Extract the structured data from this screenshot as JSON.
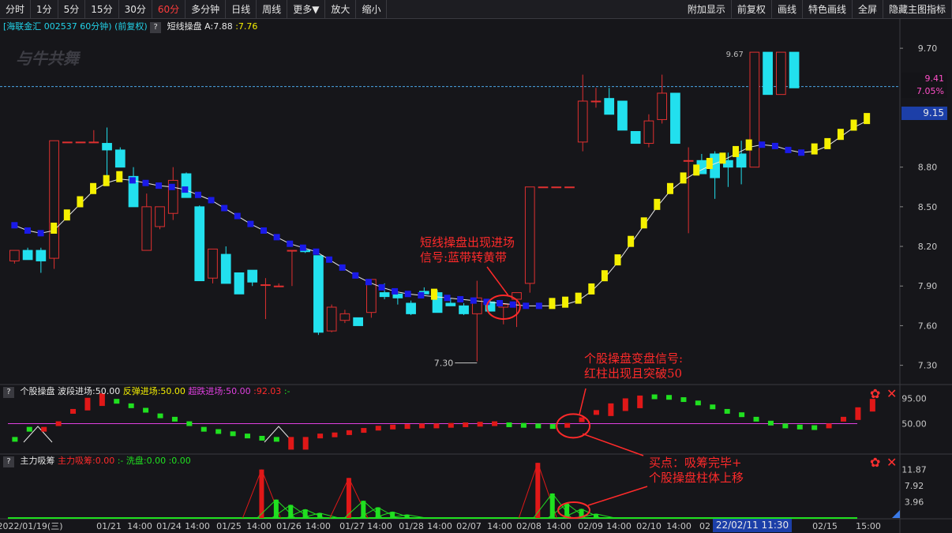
{
  "toolbar": {
    "left": [
      "分时",
      "1分",
      "5分",
      "15分",
      "30分",
      "60分",
      "多分钟",
      "日线",
      "周线",
      "更多▼",
      "放大",
      "缩小"
    ],
    "active": "60分",
    "right": [
      "附加显示",
      "前复权",
      "画线",
      "特色画线",
      "全屏",
      "隐藏主图指标"
    ]
  },
  "info": {
    "name": "[海联金汇",
    "code_period": "002537 60分钟)",
    "adjust": "(前复权)",
    "q": "?",
    "indicator": "短线操盘",
    "a_label": "A:7.88",
    "a_value": ":7.76"
  },
  "watermark": "与牛共舞",
  "price_axis": {
    "ticks": [
      "9.70",
      "9.41",
      "9.15",
      "8.80",
      "8.50",
      "8.20",
      "7.90",
      "7.60",
      "7.30"
    ],
    "current_price": "9.41",
    "current_pct": "7.05%",
    "box_price": "9.15",
    "high_label": "9.67",
    "low_label": "7.30"
  },
  "panel2": {
    "title": "个股操盘",
    "l1": "波段进场:50.00",
    "l2": "反弹进场:50.00",
    "l3": "超跌进场:50.00",
    "l4": ":92.03",
    "l5": ":-",
    "ticks": [
      "95.00",
      "50.00"
    ]
  },
  "panel3": {
    "title": "主力吸筹",
    "l1": "主力吸筹:0.00",
    "l2": ":-",
    "l3": "洗盘:0.00",
    "l4": ":0.00",
    "ticks": [
      "11.87",
      "7.92",
      "3.96"
    ]
  },
  "dates": [
    "2022/01/19(三)",
    "01/21",
    "14:00",
    "01/24",
    "14:00",
    "01/25",
    "14:00",
    "01/26",
    "14:00",
    "01/27",
    "14:00",
    "01/28",
    "14:00",
    "02/07",
    "14:00",
    "02/08",
    "14:00",
    "02/09",
    "14:00",
    "02/10",
    "14:00",
    "02",
    "2/14",
    "14:00",
    "02/15",
    "15:00"
  ],
  "time_box": "22/02/11 11:30",
  "annotations": {
    "a1": [
      "短线操盘出现进场",
      "信号:蓝带转黄带"
    ],
    "a2": [
      "个股操盘变盘信号:",
      "红柱出现且突破50"
    ],
    "a3": [
      "买点：吸筹完毕+",
      "个股操盘柱体上移"
    ]
  },
  "controls": {
    "gear": "✿",
    "close": "✕"
  },
  "colors": {
    "up": "#e03030",
    "down": "#22e0ee",
    "band_yellow": "#f5f000",
    "band_blue": "#1a1ae8",
    "macd_green": "#20e020",
    "macd_red": "#e01818",
    "fifty_line": "#e040e0",
    "annotation": "#ff2a2a"
  },
  "chart_data": {
    "type": "candlestick",
    "candles": [
      {
        "o": 8.09,
        "h": 8.16,
        "l": 8.07,
        "c": 8.17
      },
      {
        "o": 8.17,
        "h": 8.19,
        "l": 8.1,
        "c": 8.1
      },
      {
        "o": 8.17,
        "h": 8.19,
        "l": 8.0,
        "c": 8.09
      },
      {
        "o": 8.11,
        "h": 9.0,
        "l": 8.03,
        "c": 9.0
      },
      {
        "o": 8.99,
        "h": 8.99,
        "l": 8.99,
        "c": 8.99
      },
      {
        "o": 8.99,
        "h": 8.99,
        "l": 8.99,
        "c": 8.99
      },
      {
        "o": 8.99,
        "h": 9.08,
        "l": 8.99,
        "c": 8.99
      },
      {
        "o": 8.98,
        "h": 9.1,
        "l": 8.67,
        "c": 8.93
      },
      {
        "o": 8.93,
        "h": 8.95,
        "l": 8.8,
        "c": 8.8
      },
      {
        "o": 8.73,
        "h": 8.8,
        "l": 8.5,
        "c": 8.5
      },
      {
        "o": 8.17,
        "h": 8.6,
        "l": 8.17,
        "c": 8.5
      },
      {
        "o": 8.35,
        "h": 8.5,
        "l": 8.33,
        "c": 8.5
      },
      {
        "o": 8.45,
        "h": 8.8,
        "l": 8.4,
        "c": 8.7
      },
      {
        "o": 8.75,
        "h": 8.76,
        "l": 8.61,
        "c": 8.57
      },
      {
        "o": 8.5,
        "h": 8.51,
        "l": 7.94,
        "c": 7.94
      },
      {
        "o": 7.96,
        "h": 8.18,
        "l": 7.92,
        "c": 8.18
      },
      {
        "o": 8.14,
        "h": 8.2,
        "l": 7.92,
        "c": 7.92
      },
      {
        "o": 8.0,
        "h": 8.0,
        "l": 7.84,
        "c": 7.84
      },
      {
        "o": 8.02,
        "h": 8.02,
        "l": 7.9,
        "c": 7.93
      },
      {
        "o": 7.91,
        "h": 7.96,
        "l": 7.65,
        "c": 7.91
      },
      {
        "o": 7.9,
        "h": 7.92,
        "l": 7.9,
        "c": 7.9
      },
      {
        "o": 8.17,
        "h": 8.17,
        "l": 7.9,
        "c": 8.17
      },
      {
        "o": 8.17,
        "h": 8.17,
        "l": 8.15,
        "c": 8.16
      },
      {
        "o": 8.13,
        "h": 8.13,
        "l": 7.53,
        "c": 7.55
      },
      {
        "o": 7.56,
        "h": 7.76,
        "l": 7.55,
        "c": 7.74
      },
      {
        "o": 7.64,
        "h": 7.72,
        "l": 7.62,
        "c": 7.69
      },
      {
        "o": 7.66,
        "h": 7.66,
        "l": 7.6,
        "c": 7.6
      },
      {
        "o": 7.7,
        "h": 7.94,
        "l": 7.66,
        "c": 7.95
      },
      {
        "o": 7.85,
        "h": 7.92,
        "l": 7.8,
        "c": 7.82
      },
      {
        "o": 7.84,
        "h": 7.85,
        "l": 7.76,
        "c": 7.81
      },
      {
        "o": 7.77,
        "h": 7.79,
        "l": 7.68,
        "c": 7.69
      },
      {
        "o": 7.86,
        "h": 7.89,
        "l": 7.84,
        "c": 7.84
      },
      {
        "o": 7.85,
        "h": 7.87,
        "l": 7.71,
        "c": 7.7
      },
      {
        "o": 7.77,
        "h": 7.81,
        "l": 7.75,
        "c": 7.75
      },
      {
        "o": 7.75,
        "h": 7.77,
        "l": 7.68,
        "c": 7.69
      },
      {
        "o": 7.69,
        "h": 7.94,
        "l": 7.33,
        "c": 7.81
      },
      {
        "o": 7.78,
        "h": 7.79,
        "l": 7.71,
        "c": 7.71
      },
      {
        "o": 7.74,
        "h": 7.76,
        "l": 7.61,
        "c": 7.76
      },
      {
        "o": 7.8,
        "h": 7.8,
        "l": 7.59,
        "c": 7.85
      },
      {
        "o": 7.92,
        "h": 8.65,
        "l": 7.85,
        "c": 8.65
      },
      {
        "o": 8.65,
        "h": 8.65,
        "l": 8.65,
        "c": 8.65
      },
      {
        "o": 8.65,
        "h": 8.65,
        "l": 8.65,
        "c": 8.65
      },
      {
        "o": 8.65,
        "h": 8.65,
        "l": 8.65,
        "c": 8.65
      },
      {
        "o": 8.99,
        "h": 9.5,
        "l": 8.92,
        "c": 9.3
      },
      {
        "o": 9.3,
        "h": 9.4,
        "l": 9.25,
        "c": 9.3
      },
      {
        "o": 9.32,
        "h": 9.4,
        "l": 9.2,
        "c": 9.2
      },
      {
        "o": 9.3,
        "h": 9.3,
        "l": 9.08,
        "c": 9.08
      },
      {
        "o": 9.07,
        "h": 9.07,
        "l": 8.98,
        "c": 8.98
      },
      {
        "o": 8.98,
        "h": 9.2,
        "l": 8.95,
        "c": 9.15
      },
      {
        "o": 9.16,
        "h": 9.5,
        "l": 9.13,
        "c": 9.36
      },
      {
        "o": 9.36,
        "h": 9.36,
        "l": 8.98,
        "c": 8.98
      },
      {
        "o": 8.85,
        "h": 8.95,
        "l": 8.3,
        "c": 8.85
      },
      {
        "o": 8.85,
        "h": 8.9,
        "l": 8.75,
        "c": 8.75
      },
      {
        "o": 8.9,
        "h": 8.92,
        "l": 8.56,
        "c": 8.72
      },
      {
        "o": 8.85,
        "h": 8.91,
        "l": 8.65,
        "c": 8.8
      },
      {
        "o": 8.9,
        "h": 9.0,
        "l": 8.67,
        "c": 8.8
      },
      {
        "o": 8.8,
        "h": 9.67,
        "l": 8.8,
        "c": 9.67
      },
      {
        "o": 9.67,
        "h": 9.67,
        "l": 9.35,
        "c": 9.35
      },
      {
        "o": 9.35,
        "h": 9.67,
        "l": 9.35,
        "c": 9.67
      },
      {
        "o": 9.67,
        "h": 9.67,
        "l": 9.4,
        "c": 9.4
      }
    ],
    "band": [
      {
        "v": 8.36,
        "c": "b"
      },
      {
        "v": 8.32,
        "c": "b"
      },
      {
        "v": 8.3,
        "c": "b"
      },
      {
        "v": 8.32,
        "c": "y"
      },
      {
        "v": 8.42,
        "c": "y"
      },
      {
        "v": 8.52,
        "c": "y"
      },
      {
        "v": 8.62,
        "c": "y"
      },
      {
        "v": 8.68,
        "c": "y"
      },
      {
        "v": 8.71,
        "c": "y"
      },
      {
        "v": 8.7,
        "c": "b"
      },
      {
        "v": 8.68,
        "c": "b"
      },
      {
        "v": 8.66,
        "c": "b"
      },
      {
        "v": 8.65,
        "c": "b"
      },
      {
        "v": 8.63,
        "c": "b"
      },
      {
        "v": 8.59,
        "c": "b"
      },
      {
        "v": 8.55,
        "c": "b"
      },
      {
        "v": 8.49,
        "c": "b"
      },
      {
        "v": 8.43,
        "c": "b"
      },
      {
        "v": 8.37,
        "c": "b"
      },
      {
        "v": 8.32,
        "c": "b"
      },
      {
        "v": 8.27,
        "c": "b"
      },
      {
        "v": 8.22,
        "c": "b"
      },
      {
        "v": 8.19,
        "c": "b"
      },
      {
        "v": 8.16,
        "c": "b"
      },
      {
        "v": 8.1,
        "c": "b"
      },
      {
        "v": 8.04,
        "c": "b"
      },
      {
        "v": 7.98,
        "c": "b"
      },
      {
        "v": 7.93,
        "c": "b"
      },
      {
        "v": 7.89,
        "c": "b"
      },
      {
        "v": 7.86,
        "c": "b"
      },
      {
        "v": 7.84,
        "c": "b"
      },
      {
        "v": 7.83,
        "c": "b"
      },
      {
        "v": 7.82,
        "c": "y"
      },
      {
        "v": 7.81,
        "c": "b"
      },
      {
        "v": 7.8,
        "c": "b"
      },
      {
        "v": 7.79,
        "c": "b"
      },
      {
        "v": 7.78,
        "c": "b"
      },
      {
        "v": 7.77,
        "c": "b"
      },
      {
        "v": 7.76,
        "c": "b"
      },
      {
        "v": 7.75,
        "c": "b"
      },
      {
        "v": 7.75,
        "c": "b"
      },
      {
        "v": 7.75,
        "c": "y"
      },
      {
        "v": 7.76,
        "c": "y"
      },
      {
        "v": 7.79,
        "c": "y"
      },
      {
        "v": 7.86,
        "c": "y"
      },
      {
        "v": 7.96,
        "c": "y"
      },
      {
        "v": 8.08,
        "c": "y"
      },
      {
        "v": 8.22,
        "c": "y"
      },
      {
        "v": 8.36,
        "c": "y"
      },
      {
        "v": 8.5,
        "c": "y"
      },
      {
        "v": 8.62,
        "c": "y"
      },
      {
        "v": 8.7,
        "c": "y"
      },
      {
        "v": 8.76,
        "c": "y"
      },
      {
        "v": 8.81,
        "c": "y"
      },
      {
        "v": 8.85,
        "c": "y"
      },
      {
        "v": 8.9,
        "c": "y"
      },
      {
        "v": 8.95,
        "c": "y"
      },
      {
        "v": 8.97,
        "c": "b"
      },
      {
        "v": 8.96,
        "c": "b"
      },
      {
        "v": 8.93,
        "c": "b"
      },
      {
        "v": 8.91,
        "c": "b"
      },
      {
        "v": 8.92,
        "c": "y"
      },
      {
        "v": 8.96,
        "c": "y"
      },
      {
        "v": 9.03,
        "c": "y"
      },
      {
        "v": 9.1,
        "c": "y"
      },
      {
        "v": 9.15,
        "c": "y"
      }
    ],
    "panel2_bars": [
      {
        "v": 22,
        "c": "g"
      },
      {
        "v": 40,
        "c": "g"
      },
      {
        "v": 40,
        "c": "r"
      },
      {
        "v": 50,
        "c": "r"
      },
      {
        "v": 72,
        "c": "r"
      },
      {
        "v": 92,
        "c": "r"
      },
      {
        "v": 100,
        "c": "r"
      },
      {
        "v": 90,
        "c": "g"
      },
      {
        "v": 82,
        "c": "g"
      },
      {
        "v": 74,
        "c": "g"
      },
      {
        "v": 64,
        "c": "g"
      },
      {
        "v": 58,
        "c": "g"
      },
      {
        "v": 50,
        "c": "g"
      },
      {
        "v": 40,
        "c": "g"
      },
      {
        "v": 36,
        "c": "g"
      },
      {
        "v": 32,
        "c": "g"
      },
      {
        "v": 28,
        "c": "g"
      },
      {
        "v": 24,
        "c": "g"
      },
      {
        "v": 22,
        "c": "g"
      },
      {
        "v": 22,
        "c": "r"
      },
      {
        "v": 22,
        "c": "r"
      },
      {
        "v": 28,
        "c": "r"
      },
      {
        "v": 30,
        "c": "r"
      },
      {
        "v": 34,
        "c": "r"
      },
      {
        "v": 38,
        "c": "r"
      },
      {
        "v": 42,
        "c": "r"
      },
      {
        "v": 44,
        "c": "r"
      },
      {
        "v": 45,
        "c": "r"
      },
      {
        "v": 46,
        "c": "r"
      },
      {
        "v": 46,
        "c": "r"
      },
      {
        "v": 47,
        "c": "r"
      },
      {
        "v": 48,
        "c": "r"
      },
      {
        "v": 49,
        "c": "r"
      },
      {
        "v": 50,
        "c": "r"
      },
      {
        "v": 48,
        "c": "g"
      },
      {
        "v": 47,
        "c": "g"
      },
      {
        "v": 46,
        "c": "g"
      },
      {
        "v": 45,
        "c": "g"
      },
      {
        "v": 47,
        "c": "r"
      },
      {
        "v": 57,
        "c": "r"
      },
      {
        "v": 70,
        "c": "r"
      },
      {
        "v": 82,
        "c": "r"
      },
      {
        "v": 91,
        "c": "r"
      },
      {
        "v": 96,
        "c": "r"
      },
      {
        "v": 98,
        "c": "g"
      },
      {
        "v": 97,
        "c": "g"
      },
      {
        "v": 93,
        "c": "g"
      },
      {
        "v": 87,
        "c": "g"
      },
      {
        "v": 80,
        "c": "g"
      },
      {
        "v": 72,
        "c": "g"
      },
      {
        "v": 66,
        "c": "g"
      },
      {
        "v": 58,
        "c": "g"
      },
      {
        "v": 51,
        "c": "g"
      },
      {
        "v": 46,
        "c": "g"
      },
      {
        "v": 44,
        "c": "g"
      },
      {
        "v": 43,
        "c": "g"
      },
      {
        "v": 46,
        "c": "r"
      },
      {
        "v": 58,
        "c": "r"
      },
      {
        "v": 75,
        "c": "r"
      },
      {
        "v": 90,
        "c": "r"
      }
    ],
    "panel3_spikes": [
      {
        "i": 17,
        "v": 11.87,
        "c": "r"
      },
      {
        "i": 18,
        "v": 4.5,
        "c": "g"
      },
      {
        "i": 19,
        "v": 3.2,
        "c": "g"
      },
      {
        "i": 20,
        "v": 2.1,
        "c": "g"
      },
      {
        "i": 21,
        "v": 1.2,
        "c": "g"
      },
      {
        "i": 23,
        "v": 9.8,
        "c": "r"
      },
      {
        "i": 24,
        "v": 4.2,
        "c": "g"
      },
      {
        "i": 25,
        "v": 2.6,
        "c": "g"
      },
      {
        "i": 26,
        "v": 1.5,
        "c": "g"
      },
      {
        "i": 27,
        "v": 0.8,
        "c": "g"
      },
      {
        "i": 36,
        "v": 13.5,
        "c": "r"
      },
      {
        "i": 37,
        "v": 6.0,
        "c": "g"
      },
      {
        "i": 38,
        "v": 3.5,
        "c": "g"
      },
      {
        "i": 39,
        "v": 2.2,
        "c": "g"
      },
      {
        "i": 40,
        "v": 1.0,
        "c": "g"
      }
    ],
    "price_range": [
      7.22,
      9.85
    ],
    "panel2_range": [
      0,
      110
    ],
    "panel3_range": [
      0,
      14.5
    ]
  }
}
